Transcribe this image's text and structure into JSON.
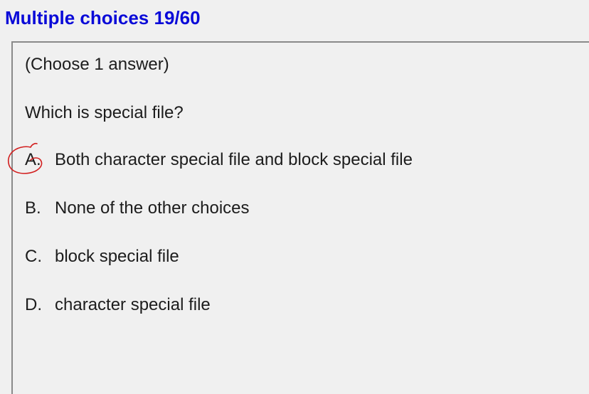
{
  "header": {
    "title": "Multiple choices 19/60"
  },
  "question": {
    "instruction": "(Choose 1 answer)",
    "text": "Which is special file?",
    "choices": [
      {
        "letter": "A.",
        "text": "Both character special file and block special file"
      },
      {
        "letter": "B.",
        "text": "None of the other choices"
      },
      {
        "letter": "C.",
        "text": "block special file"
      },
      {
        "letter": "D.",
        "text": "character special file"
      }
    ]
  },
  "annotation": {
    "marked_choice": "A",
    "icon": "hand-drawn-circle-icon",
    "color": "#d21e1e"
  },
  "colors": {
    "title": "#0a0ad8",
    "background": "#f0f0f0",
    "text": "#1c1c1c"
  }
}
